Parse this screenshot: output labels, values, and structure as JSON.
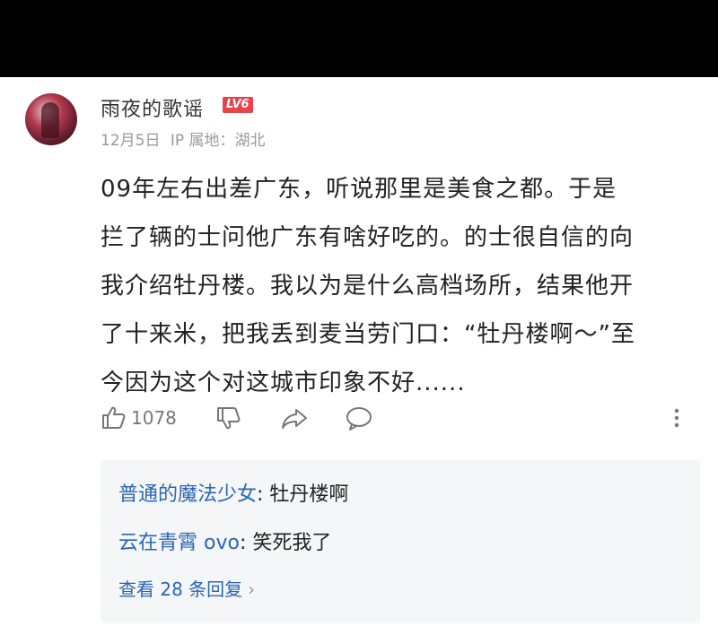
{
  "comment": {
    "author": "雨夜的歌谣",
    "level": "LV6",
    "date": "12月5日",
    "ip_location": "IP 属地：湖北",
    "text_lines": [
      "09年左右出差广东，听说那里是美食之都。于是",
      "拦了辆的士问他广东有啥好吃的。的士很自信的向",
      "我介绍牡丹楼。我以为是什么高档场所，结果他开",
      "了十来米，把我丢到麦当劳门口：“牡丹楼啊～”至",
      "今因为这个对这城市印象不好......"
    ],
    "like_count": "1078"
  },
  "replies": {
    "items": [
      {
        "name": "普通的魔法少女",
        "text": ": 牡丹楼啊"
      },
      {
        "name": "云在青霄 ovo",
        "text": ": 笑死我了"
      }
    ],
    "view_more": "查看 28 条回复"
  },
  "icons": {
    "like": "thumbs-up-icon",
    "dislike": "thumbs-down-icon",
    "share": "share-icon",
    "reply": "comment-bubble-icon",
    "more": "more-vertical-icon"
  }
}
